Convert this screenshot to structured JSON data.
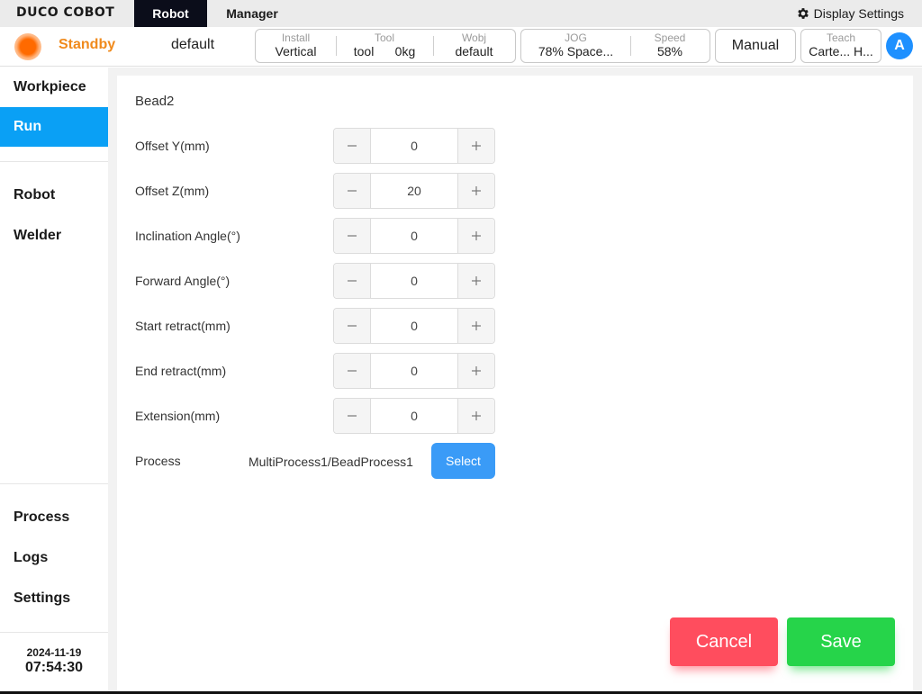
{
  "topbar": {
    "logo": "DUCO COBOT",
    "tabs": [
      {
        "label": "Robot"
      },
      {
        "label": "Manager"
      }
    ],
    "display_settings": "Display Settings"
  },
  "status": {
    "state": "Standby",
    "program": "default",
    "install": {
      "caption": "Install",
      "value": "Vertical"
    },
    "tool": {
      "caption": "Tool",
      "name": "tool",
      "weight": "0kg"
    },
    "wobj": {
      "caption": "Wobj",
      "value": "default"
    },
    "jog": {
      "caption": "JOG",
      "value": "78%  Space..."
    },
    "speed": {
      "caption": "Speed",
      "value": "58%"
    },
    "mode": "Manual",
    "teach": {
      "caption": "Teach",
      "value": "Carte... H..."
    },
    "avatar": "A"
  },
  "sidebar": {
    "items": [
      {
        "label": "Workpiece"
      },
      {
        "label": "Run"
      },
      {
        "label": "Robot"
      },
      {
        "label": "Welder"
      },
      {
        "label": "Process"
      },
      {
        "label": "Logs"
      },
      {
        "label": "Settings"
      }
    ],
    "date": "2024-11-19",
    "time": "07:54:30"
  },
  "form": {
    "title": "Bead2",
    "fields": [
      {
        "label": "Offset Y(mm)",
        "value": "0"
      },
      {
        "label": "Offset Z(mm)",
        "value": "20"
      },
      {
        "label": "Inclination Angle(°)",
        "value": "0"
      },
      {
        "label": "Forward Angle(°)",
        "value": "0"
      },
      {
        "label": "Start retract(mm)",
        "value": "0"
      },
      {
        "label": "End retract(mm)",
        "value": "0"
      },
      {
        "label": "Extension(mm)",
        "value": "0"
      }
    ],
    "process_label": "Process",
    "process_value": "MultiProcess1/BeadProcess1",
    "select_label": "Select"
  },
  "actions": {
    "cancel": "Cancel",
    "save": "Save"
  },
  "colors": {
    "accent": "#0aa0f5",
    "standby": "#f08a1c",
    "cancel": "#ff4d5e",
    "save": "#26d44a",
    "select": "#3a9bf7"
  }
}
